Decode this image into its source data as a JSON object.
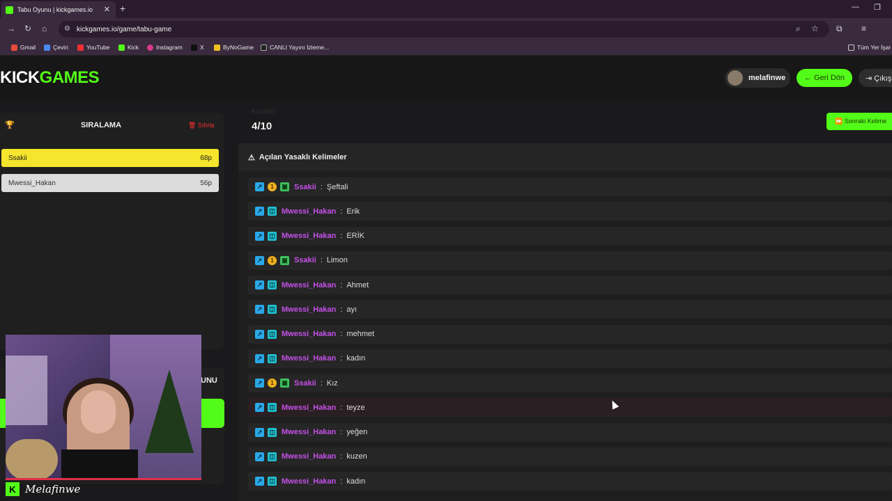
{
  "browser": {
    "tab_title": "Tabu Oyunu | kickgames.io",
    "url": "kickgames.io/game/tabu-game",
    "bookmarks": [
      "Gmail",
      "Çeviri",
      "YouTube",
      "Kick",
      "Instagram",
      "X",
      "ByNoGame",
      "CANLI Yayını İzleme...",
      "Tüm Yer İşar"
    ]
  },
  "header": {
    "logo_part1": "KICK",
    "logo_part2": "GAMES",
    "username": "melafinwe",
    "back_label": "← Geri Dön",
    "exit_label": "⇥ Çıkış"
  },
  "ranking": {
    "title": "SIRALAMA",
    "reset_label": "🗑 Sıfırla",
    "entries": [
      {
        "name": "Ssakii",
        "points": "68p"
      },
      {
        "name": "Mwessi_Hakan",
        "points": "56p"
      }
    ]
  },
  "lower_panel": {
    "title_fragment": "UNU"
  },
  "webcam": {
    "name": "Melafinwe"
  },
  "game": {
    "round_label": "ROUND",
    "round": "4/10",
    "next_button": "⏩ Sonraki Kelime"
  },
  "forbidden": {
    "title": "Açılan Yasaklı Kelimeler",
    "rows": [
      {
        "user": "Ssakii",
        "word": "Şeftali",
        "type": "coin"
      },
      {
        "user": "Mwessi_Hakan",
        "word": "Erik",
        "type": "sub"
      },
      {
        "user": "Mwessi_Hakan",
        "word": "ERİK",
        "type": "sub"
      },
      {
        "user": "Ssakii",
        "word": "Limon",
        "type": "coin"
      },
      {
        "user": "Mwessi_Hakan",
        "word": "Ahmet",
        "type": "sub"
      },
      {
        "user": "Mwessi_Hakan",
        "word": "ayı",
        "type": "sub"
      },
      {
        "user": "Mwessi_Hakan",
        "word": "mehmet",
        "type": "sub"
      },
      {
        "user": "Mwessi_Hakan",
        "word": "kadın",
        "type": "sub"
      },
      {
        "user": "Ssakii",
        "word": "Kız",
        "type": "coin"
      },
      {
        "user": "Mwessi_Hakan",
        "word": "teyze",
        "type": "sub"
      },
      {
        "user": "Mwessi_Hakan",
        "word": "yeğen",
        "type": "sub"
      },
      {
        "user": "Mwessi_Hakan",
        "word": "kuzen",
        "type": "sub"
      },
      {
        "user": "Mwessi_Hakan",
        "word": "kadın",
        "type": "sub"
      }
    ]
  },
  "colors": {
    "accent": "#53fc18",
    "username": "#c450e8",
    "first_place": "#f5e52c"
  }
}
